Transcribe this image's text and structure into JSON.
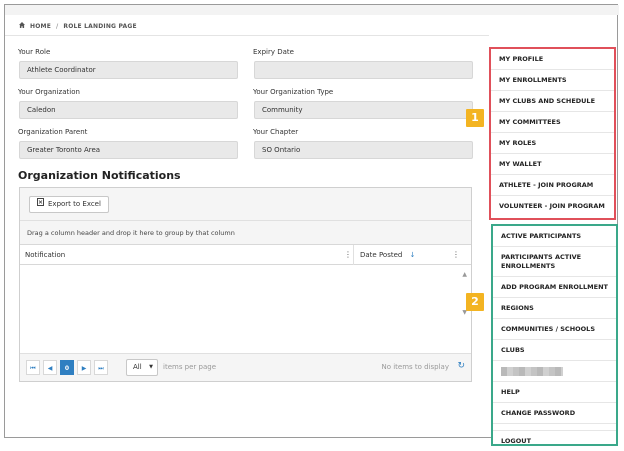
{
  "breadcrumb": {
    "home": "HOME",
    "current": "ROLE LANDING PAGE"
  },
  "form": {
    "role_label": "Your Role",
    "role_value": "Athlete Coordinator",
    "expiry_label": "Expiry Date",
    "expiry_value": "",
    "org_label": "Your Organization",
    "org_value": "Caledon",
    "org_type_label": "Your Organization Type",
    "org_type_value": "Community",
    "parent_label": "Organization Parent",
    "parent_value": "Greater Toronto Area",
    "chapter_label": "Your Chapter",
    "chapter_value": "SO Ontario"
  },
  "notifications": {
    "title": "Organization Notifications",
    "export_label": "Export to Excel",
    "group_hint": "Drag a column header and drop it here to group by that column",
    "columns": [
      "Notification",
      "Date Posted"
    ],
    "pager": {
      "first": "⏮",
      "prev": "◀",
      "page": "0",
      "next": "▶",
      "last": "⏭"
    },
    "page_size": "All",
    "items_per_page": "items per page",
    "no_items": "No items to display"
  },
  "menu_primary": [
    "MY PROFILE",
    "MY ENROLLMENTS",
    "MY CLUBS AND SCHEDULE",
    "MY COMMITTEES",
    "MY ROLES",
    "MY WALLET",
    "ATHLETE - JOIN PROGRAM",
    "VOLUNTEER - JOIN PROGRAM"
  ],
  "menu_secondary": {
    "active_participants": "ACTIVE PARTICIPANTS",
    "participants_active_enrollments": "PARTICIPANTS ACTIVE ENROLLMENTS",
    "add_program_enrollment": "ADD PROGRAM ENROLLMENT",
    "regions": "REGIONS",
    "communities_schools": "COMMUNITIES / SCHOOLS",
    "clubs": "CLUBS",
    "help": "HELP",
    "change_password": "CHANGE PASSWORD",
    "logout": "LOGOUT"
  },
  "callouts": {
    "one": "1",
    "two": "2"
  },
  "colors": {
    "accent": "#2f7fc1",
    "callout": "#f3b422",
    "red_box": "#e0505a",
    "green_box": "#3aa88a"
  }
}
